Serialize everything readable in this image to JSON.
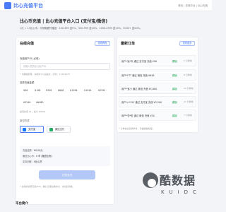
{
  "topbar": {
    "logo": "比心充值平台",
    "breadcrumb": "首页 | 充值平台 | 比心充值"
  },
  "page": {
    "heading": "比心币充值 | 比心充值平台入口 (支付宝/微信)",
    "subline": "1元 = 10比心币，可领取额外赠送：100-499 送5%，500-999 送10%，1000-4999 送15%，5000+ 送20%。"
  },
  "recharge": {
    "title": "在线充值",
    "side_button": "查看教程",
    "account_label": "充值用户ID (必填)",
    "account_placeholder": "请输入您的比心用户ID",
    "account_hint": "* 为确保到账，请核对 ID 后提交，示例：12345678",
    "amount_label": "选择充值金额",
    "amounts": [
      "¥98",
      "¥198",
      "¥328",
      "¥648",
      "¥1296",
      "¥1944",
      "¥2592",
      "¥3240",
      "¥6480"
    ],
    "custom_hint": "最低充值 ¥1，最大 ¥5000",
    "custom_label": "自定义",
    "pay_label": "支付方式",
    "pay_options": [
      {
        "label": "支付宝",
        "color": "#1677ff"
      },
      {
        "label": "微信支付",
        "color": "#2aae67"
      }
    ],
    "summary": {
      "rows": [
        {
          "k": "充值金额：",
          "v": "¥0.00元"
        },
        {
          "k": "赠送比心币：",
          "v": "0 币 (赠送比例)"
        },
        {
          "k": "实际到账：",
          "v": "0比心币"
        }
      ]
    },
    "submit": "立即支付",
    "footnote": "* 充值前请核实用户ID，确认无误后再支付，支付后到账。"
  },
  "orders": {
    "title": "最新订单",
    "more": "查看更多",
    "items": [
      {
        "desc": "用户*凌*毒 通过 支付宝 充值 ¥98",
        "status": "成功",
        "time": "5 分钟前"
      },
      {
        "desc": "用户*FTT 通过 微信 充值 ¥648",
        "status": "成功",
        "time": "8 分钟前"
      },
      {
        "desc": "用户*宝小 通过 微信 充值 ¥1,680",
        "status": "成功",
        "time": "16 分钟前"
      },
      {
        "desc": "用户*n*155 通过 支付宝 充值 ¥3,500",
        "status": "成功",
        "time": "21 分钟前"
      },
      {
        "desc": "用户*李*哲 通过 微信 充值 ¥30",
        "status": "成功",
        "time": "7 分钟前"
      }
    ],
    "note": "* 订单信息仅供参考，已做脱敏处理。"
  },
  "platform": {
    "title": "平台简介"
  },
  "watermark": {
    "text": "酷数据",
    "sub": "KUIDC"
  }
}
